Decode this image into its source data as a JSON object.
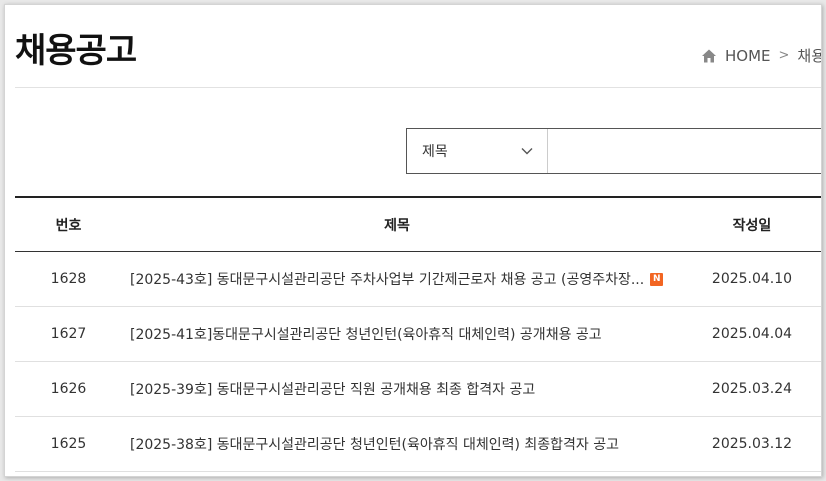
{
  "page": {
    "title": "채용공고"
  },
  "breadcrumb": {
    "home": "HOME",
    "separator": ">",
    "current": "채용"
  },
  "search": {
    "select_value": "제목",
    "placeholder": ""
  },
  "table": {
    "headers": {
      "num": "번호",
      "title": "제목",
      "date": "작성일"
    },
    "rows": [
      {
        "num": "1628",
        "title": "[2025-43호] 동대문구시설관리공단 주차사업부 기간제근로자 채용 공고 (공영주차장...",
        "date": "2025.04.10",
        "badge": "N"
      },
      {
        "num": "1627",
        "title": "[2025-41호]동대문구시설관리공단 청년인턴(육아휴직 대체인력) 공개채용 공고",
        "date": "2025.04.04"
      },
      {
        "num": "1626",
        "title": "[2025-39호] 동대문구시설관리공단 직원 공개채용 최종 합격자 공고",
        "date": "2025.03.24"
      },
      {
        "num": "1625",
        "title": "[2025-38호] 동대문구시설관리공단 청년인턴(육아휴직 대체인력) 최종합격자 공고",
        "date": "2025.03.12"
      }
    ]
  },
  "colors": {
    "new_badge": "#f26522",
    "table_top_border": "#222222"
  }
}
